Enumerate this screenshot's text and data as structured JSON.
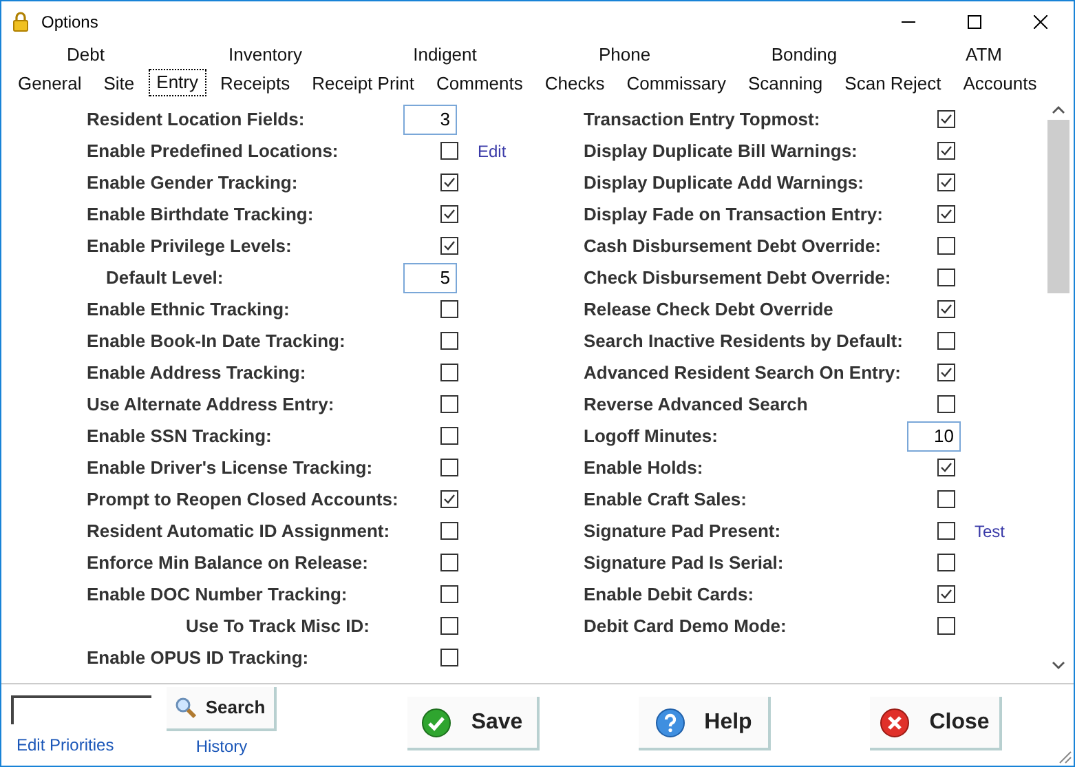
{
  "window": {
    "title": "Options"
  },
  "tabs_top": [
    {
      "label": "Debt",
      "selected": false
    },
    {
      "label": "Inventory",
      "selected": false
    },
    {
      "label": "Indigent",
      "selected": false
    },
    {
      "label": "Phone",
      "selected": false
    },
    {
      "label": "Bonding",
      "selected": false
    },
    {
      "label": "ATM",
      "selected": false
    }
  ],
  "tabs_bottom": [
    {
      "label": "General",
      "selected": false
    },
    {
      "label": "Site",
      "selected": false
    },
    {
      "label": "Entry",
      "selected": true
    },
    {
      "label": "Receipts",
      "selected": false
    },
    {
      "label": "Receipt Print",
      "selected": false
    },
    {
      "label": "Comments",
      "selected": false
    },
    {
      "label": "Checks",
      "selected": false
    },
    {
      "label": "Commissary",
      "selected": false
    },
    {
      "label": "Scanning",
      "selected": false
    },
    {
      "label": "Scan Reject",
      "selected": false
    },
    {
      "label": "Accounts",
      "selected": false
    }
  ],
  "left_options": [
    {
      "kind": "number",
      "label": "Resident Location Fields:",
      "value": "3"
    },
    {
      "kind": "check",
      "label": "Enable Predefined Locations:",
      "checked": false,
      "link": "Edit"
    },
    {
      "kind": "check",
      "label": "Enable Gender Tracking:",
      "checked": true
    },
    {
      "kind": "check",
      "label": "Enable Birthdate Tracking:",
      "checked": true
    },
    {
      "kind": "check",
      "label": "Enable Privilege Levels:",
      "checked": true,
      "children": [
        {
          "kind": "number",
          "label": "Default Level:",
          "value": "5"
        }
      ]
    },
    {
      "kind": "check",
      "label": "Enable Ethnic Tracking:",
      "checked": false
    },
    {
      "kind": "check",
      "label": "Enable Book-In Date Tracking:",
      "checked": false
    },
    {
      "kind": "check",
      "label": "Enable Address Tracking:",
      "checked": false
    },
    {
      "kind": "check",
      "label": "Use Alternate Address Entry:",
      "checked": false
    },
    {
      "kind": "check",
      "label": "Enable SSN Tracking:",
      "checked": false
    },
    {
      "kind": "check",
      "label": "Enable Driver's License Tracking:",
      "checked": false
    },
    {
      "kind": "check",
      "label": "Prompt to Reopen Closed Accounts:",
      "checked": true
    },
    {
      "kind": "check",
      "label": "Resident Automatic ID Assignment:",
      "checked": false
    },
    {
      "kind": "check",
      "label": "Enforce Min Balance on Release:",
      "checked": false
    },
    {
      "kind": "check",
      "label": "Enable DOC Number Tracking:",
      "checked": false,
      "children": [
        {
          "kind": "check",
          "label": "Use To Track Misc ID:",
          "checked": false
        }
      ]
    },
    {
      "kind": "check",
      "label": "Enable OPUS ID Tracking:",
      "checked": false
    }
  ],
  "right_options": [
    {
      "kind": "check",
      "label": "Transaction Entry Topmost:",
      "checked": true
    },
    {
      "kind": "check",
      "label": "Display Duplicate Bill Warnings:",
      "checked": true
    },
    {
      "kind": "check",
      "label": "Display Duplicate Add Warnings:",
      "checked": true
    },
    {
      "kind": "check",
      "label": "Display Fade on Transaction Entry:",
      "checked": true
    },
    {
      "kind": "check",
      "label": "Cash Disbursement Debt Override:",
      "checked": false
    },
    {
      "kind": "check",
      "label": "Check Disbursement Debt Override:",
      "checked": false
    },
    {
      "kind": "check",
      "label": "Release Check Debt Override",
      "checked": true
    },
    {
      "kind": "check",
      "label": "Search Inactive Residents by Default:",
      "checked": false
    },
    {
      "kind": "check",
      "label": "Advanced Resident Search On Entry:",
      "checked": true
    },
    {
      "kind": "check",
      "label": "Reverse Advanced Search",
      "checked": false
    },
    {
      "kind": "number",
      "label": "Logoff Minutes:",
      "value": "10"
    },
    {
      "kind": "check",
      "label": "Enable Holds:",
      "checked": true
    },
    {
      "kind": "check",
      "label": "Enable Craft Sales:",
      "checked": false
    },
    {
      "kind": "check",
      "label": "Signature Pad Present:",
      "checked": false,
      "link": "Test"
    },
    {
      "kind": "check",
      "label": "Signature Pad Is Serial:",
      "checked": false
    },
    {
      "kind": "check",
      "label": "Enable Debit Cards:",
      "checked": true
    },
    {
      "kind": "check",
      "label": "Debit Card Demo Mode:",
      "checked": false
    }
  ],
  "footer": {
    "search_button": "Search",
    "edit_priorities_link": "Edit Priorities",
    "history_link": "History",
    "buttons": [
      {
        "kind": "save",
        "label": "Save"
      },
      {
        "kind": "help",
        "label": "Help"
      },
      {
        "kind": "close",
        "label": "Close"
      }
    ]
  }
}
